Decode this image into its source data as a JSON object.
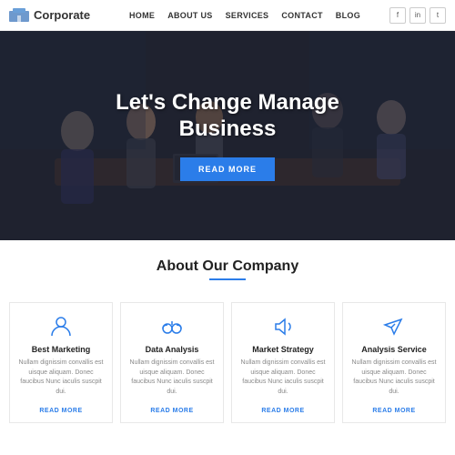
{
  "header": {
    "logo_text": "Corporate",
    "nav_items": [
      {
        "label": "HOME",
        "id": "home"
      },
      {
        "label": "ABOUT US",
        "id": "about"
      },
      {
        "label": "SERVICES",
        "id": "services"
      },
      {
        "label": "CONTACT",
        "id": "contact"
      },
      {
        "label": "BLOG",
        "id": "blog"
      }
    ],
    "social": [
      {
        "icon": "f",
        "label": "facebook"
      },
      {
        "icon": "in",
        "label": "linkedin"
      },
      {
        "icon": "t",
        "label": "twitter"
      }
    ]
  },
  "hero": {
    "title_line1": "Let's Change Manage",
    "title_line2": "Business",
    "btn_label": "READ MORE"
  },
  "about": {
    "title": "About Our Company",
    "cards": [
      {
        "id": "best-marketing",
        "icon": "person",
        "title": "Best Marketing",
        "text": "Nullam dignissim convallis est uisque aliquam. Donec faucibus Nunc iaculis suscpit dui.",
        "link": "READ MORE"
      },
      {
        "id": "data-analysis",
        "icon": "glasses",
        "title": "Data Analysis",
        "text": "Nullam dignissim convallis est uisque aliquam. Donec faucibus Nunc iaculis suscpit dui.",
        "link": "READ MORE"
      },
      {
        "id": "market-strategy",
        "icon": "megaphone",
        "title": "Market Strategy",
        "text": "Nullam dignissim convallis est uisque aliquam. Donec faucibus Nunc iaculis suscpit dui.",
        "link": "READ MORE"
      },
      {
        "id": "analysis-service",
        "icon": "send",
        "title": "Analysis Service",
        "text": "Nullam dignissim convallis est uisque aliquam. Donec faucibus Nunc iaculis suscpit dui.",
        "link": "READ MORE"
      }
    ]
  }
}
